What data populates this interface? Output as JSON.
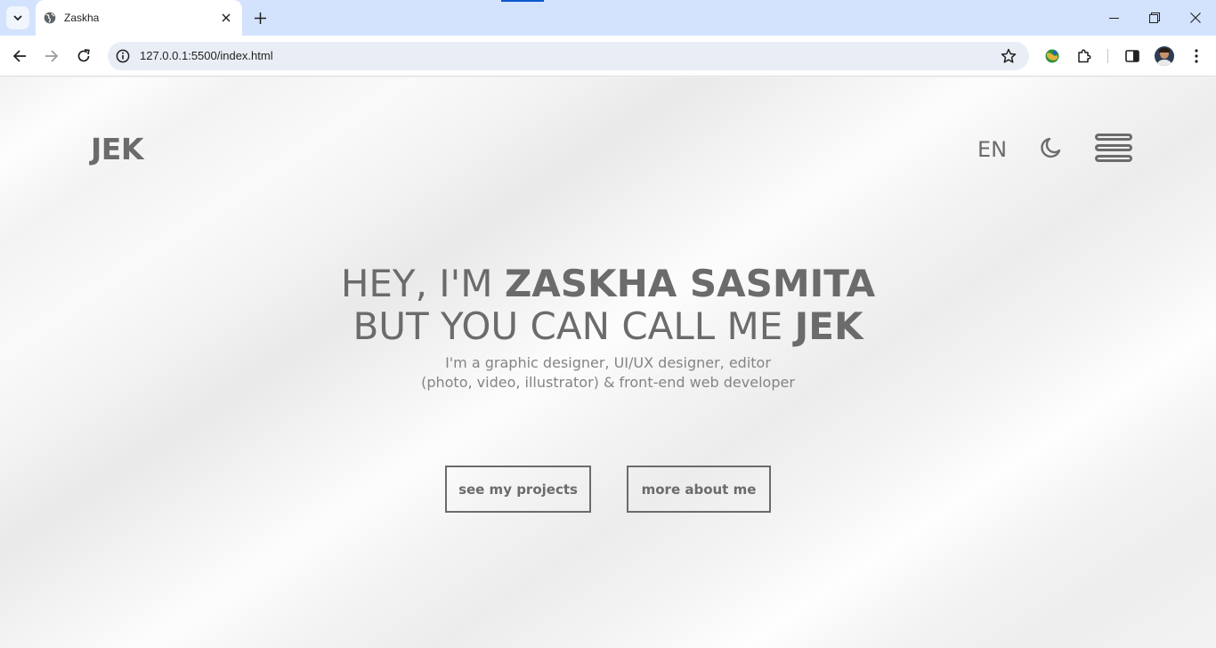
{
  "browser": {
    "tab_title": "Zaskha",
    "url": "127.0.0.1:5500/index.html",
    "icons": [
      "tab-search-icon",
      "globe-icon",
      "close-icon",
      "plus-icon",
      "minimize-icon",
      "restore-icon",
      "close-window-icon",
      "back-icon",
      "forward-icon",
      "reload-icon",
      "site-info-icon",
      "star-icon",
      "extension-globe-icon",
      "puzzle-icon",
      "side-panel-icon",
      "profile-avatar",
      "kebab-menu-icon"
    ],
    "accent": "#0b57d0",
    "tabbar_color": "#d3e3fd"
  },
  "site": {
    "logo": "JEK",
    "lang": "EN",
    "theme_icon": "moon-icon",
    "menu_icon": "hamburger-icon",
    "text_color": "#6b6b6b"
  },
  "hero": {
    "line1_light": "HEY, I'M ",
    "line1_bold": "ZASKHA SASMITA",
    "line2_light": "BUT YOU CAN CALL ME ",
    "line2_bold": "JEK",
    "subtitle": "I'm a graphic designer, UI/UX designer, editor (photo, video, illustrator) & front-end web developer"
  },
  "buttons": {
    "projects": "see my projects",
    "about": "more about me"
  }
}
